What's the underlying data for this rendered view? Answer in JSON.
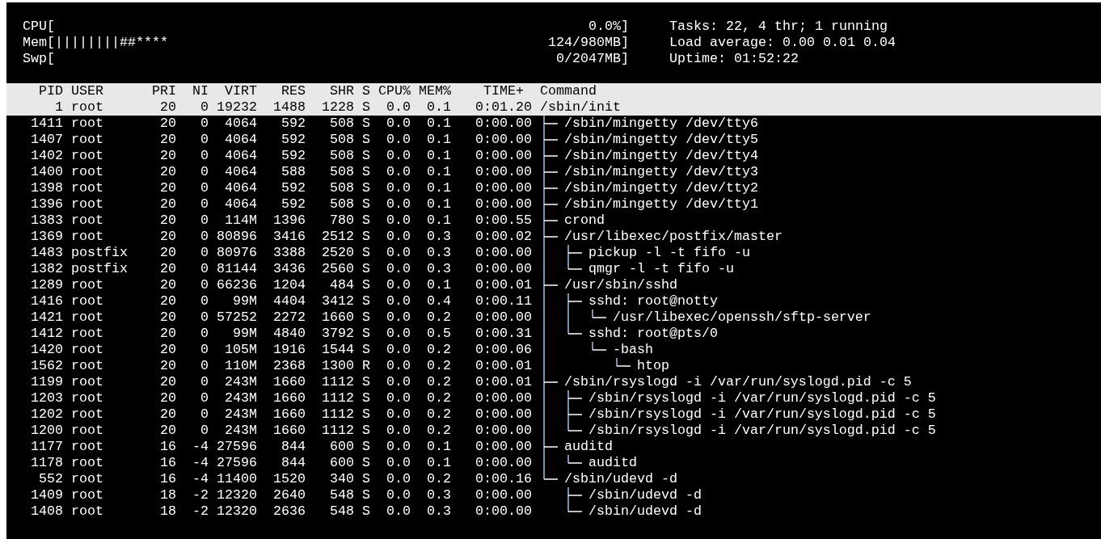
{
  "meters": [
    {
      "label": "CPU[",
      "value": "0.0%]"
    },
    {
      "label": "Mem[",
      "bar": "||||||||##****",
      "value": "124/980MB]"
    },
    {
      "label": "Swp[",
      "value": "0/2047MB]"
    }
  ],
  "summary": [
    "Tasks: 22, 4 thr; 1 running",
    "Load average: 0.00 0.01 0.04",
    "Uptime: 01:52:22"
  ],
  "columns": [
    "PID",
    "USER",
    "PRI",
    "NI",
    "VIRT",
    "RES",
    "SHR",
    "S",
    "CPU%",
    "MEM%",
    "TIME+",
    "Command"
  ],
  "processes": [
    {
      "pid": "1",
      "user": "root",
      "pri": "20",
      "ni": "0",
      "virt": "19232",
      "res": "1488",
      "shr": "1228",
      "s": "S",
      "cpu": "0.0",
      "mem": "0.1",
      "time": "0:01.20",
      "command": "/sbin/init",
      "selected": true,
      "children": [
        {
          "pid": "1411",
          "user": "root",
          "pri": "20",
          "ni": "0",
          "virt": "4064",
          "res": "592",
          "shr": "508",
          "s": "S",
          "cpu": "0.0",
          "mem": "0.1",
          "time": "0:00.00",
          "command": "/sbin/mingetty /dev/tty6",
          "selected": false
        },
        {
          "pid": "1407",
          "user": "root",
          "pri": "20",
          "ni": "0",
          "virt": "4064",
          "res": "592",
          "shr": "508",
          "s": "S",
          "cpu": "0.0",
          "mem": "0.1",
          "time": "0:00.00",
          "command": "/sbin/mingetty /dev/tty5",
          "selected": false
        },
        {
          "pid": "1402",
          "user": "root",
          "pri": "20",
          "ni": "0",
          "virt": "4064",
          "res": "592",
          "shr": "508",
          "s": "S",
          "cpu": "0.0",
          "mem": "0.1",
          "time": "0:00.00",
          "command": "/sbin/mingetty /dev/tty4",
          "selected": false
        },
        {
          "pid": "1400",
          "user": "root",
          "pri": "20",
          "ni": "0",
          "virt": "4064",
          "res": "588",
          "shr": "508",
          "s": "S",
          "cpu": "0.0",
          "mem": "0.1",
          "time": "0:00.00",
          "command": "/sbin/mingetty /dev/tty3",
          "selected": false
        },
        {
          "pid": "1398",
          "user": "root",
          "pri": "20",
          "ni": "0",
          "virt": "4064",
          "res": "592",
          "shr": "508",
          "s": "S",
          "cpu": "0.0",
          "mem": "0.1",
          "time": "0:00.00",
          "command": "/sbin/mingetty /dev/tty2",
          "selected": false
        },
        {
          "pid": "1396",
          "user": "root",
          "pri": "20",
          "ni": "0",
          "virt": "4064",
          "res": "592",
          "shr": "508",
          "s": "S",
          "cpu": "0.0",
          "mem": "0.1",
          "time": "0:00.00",
          "command": "/sbin/mingetty /dev/tty1",
          "selected": false
        },
        {
          "pid": "1383",
          "user": "root",
          "pri": "20",
          "ni": "0",
          "virt": "114M",
          "res": "1396",
          "shr": "780",
          "s": "S",
          "cpu": "0.0",
          "mem": "0.1",
          "time": "0:00.55",
          "command": "crond",
          "selected": false
        },
        {
          "pid": "1369",
          "user": "root",
          "pri": "20",
          "ni": "0",
          "virt": "80896",
          "res": "3416",
          "shr": "2512",
          "s": "S",
          "cpu": "0.0",
          "mem": "0.3",
          "time": "0:00.02",
          "command": "/usr/libexec/postfix/master",
          "selected": false,
          "children": [
            {
              "pid": "1483",
              "user": "postfix",
              "pri": "20",
              "ni": "0",
              "virt": "80976",
              "res": "3388",
              "shr": "2520",
              "s": "S",
              "cpu": "0.0",
              "mem": "0.3",
              "time": "0:00.00",
              "command": "pickup -l -t fifo -u",
              "selected": false
            },
            {
              "pid": "1382",
              "user": "postfix",
              "pri": "20",
              "ni": "0",
              "virt": "81144",
              "res": "3436",
              "shr": "2560",
              "s": "S",
              "cpu": "0.0",
              "mem": "0.3",
              "time": "0:00.00",
              "command": "qmgr -l -t fifo -u",
              "selected": false
            }
          ]
        },
        {
          "pid": "1289",
          "user": "root",
          "pri": "20",
          "ni": "0",
          "virt": "66236",
          "res": "1204",
          "shr": "484",
          "s": "S",
          "cpu": "0.0",
          "mem": "0.1",
          "time": "0:00.01",
          "command": "/usr/sbin/sshd",
          "selected": false,
          "children": [
            {
              "pid": "1416",
              "user": "root",
              "pri": "20",
              "ni": "0",
              "virt": "99M",
              "res": "4404",
              "shr": "3412",
              "s": "S",
              "cpu": "0.0",
              "mem": "0.4",
              "time": "0:00.11",
              "command": "sshd: root@notty",
              "selected": false,
              "children": [
                {
                  "pid": "1421",
                  "user": "root",
                  "pri": "20",
                  "ni": "0",
                  "virt": "57252",
                  "res": "2272",
                  "shr": "1660",
                  "s": "S",
                  "cpu": "0.0",
                  "mem": "0.2",
                  "time": "0:00.00",
                  "command": "/usr/libexec/openssh/sftp-server",
                  "selected": false
                }
              ]
            },
            {
              "pid": "1412",
              "user": "root",
              "pri": "20",
              "ni": "0",
              "virt": "99M",
              "res": "4840",
              "shr": "3792",
              "s": "S",
              "cpu": "0.0",
              "mem": "0.5",
              "time": "0:00.31",
              "command": "sshd: root@pts/0",
              "selected": false,
              "children": [
                {
                  "pid": "1420",
                  "user": "root",
                  "pri": "20",
                  "ni": "0",
                  "virt": "105M",
                  "res": "1916",
                  "shr": "1544",
                  "s": "S",
                  "cpu": "0.0",
                  "mem": "0.2",
                  "time": "0:00.06",
                  "command": "-bash",
                  "selected": false,
                  "children": [
                    {
                      "pid": "1562",
                      "user": "root",
                      "pri": "20",
                      "ni": "0",
                      "virt": "110M",
                      "res": "2368",
                      "shr": "1300",
                      "s": "R",
                      "cpu": "0.0",
                      "mem": "0.2",
                      "time": "0:00.01",
                      "command": "htop",
                      "selected": false
                    }
                  ]
                }
              ]
            }
          ]
        },
        {
          "pid": "1199",
          "user": "root",
          "pri": "20",
          "ni": "0",
          "virt": "243M",
          "res": "1660",
          "shr": "1112",
          "s": "S",
          "cpu": "0.0",
          "mem": "0.2",
          "time": "0:00.01",
          "command": "/sbin/rsyslogd -i /var/run/syslogd.pid -c 5",
          "selected": false,
          "children": [
            {
              "pid": "1203",
              "user": "root",
              "pri": "20",
              "ni": "0",
              "virt": "243M",
              "res": "1660",
              "shr": "1112",
              "s": "S",
              "cpu": "0.0",
              "mem": "0.2",
              "time": "0:00.00",
              "command": "/sbin/rsyslogd -i /var/run/syslogd.pid -c 5",
              "selected": false
            },
            {
              "pid": "1202",
              "user": "root",
              "pri": "20",
              "ni": "0",
              "virt": "243M",
              "res": "1660",
              "shr": "1112",
              "s": "S",
              "cpu": "0.0",
              "mem": "0.2",
              "time": "0:00.00",
              "command": "/sbin/rsyslogd -i /var/run/syslogd.pid -c 5",
              "selected": false
            },
            {
              "pid": "1200",
              "user": "root",
              "pri": "20",
              "ni": "0",
              "virt": "243M",
              "res": "1660",
              "shr": "1112",
              "s": "S",
              "cpu": "0.0",
              "mem": "0.2",
              "time": "0:00.00",
              "command": "/sbin/rsyslogd -i /var/run/syslogd.pid -c 5",
              "selected": false
            }
          ]
        },
        {
          "pid": "1177",
          "user": "root",
          "pri": "16",
          "ni": "-4",
          "virt": "27596",
          "res": "844",
          "shr": "600",
          "s": "S",
          "cpu": "0.0",
          "mem": "0.1",
          "time": "0:00.00",
          "command": "auditd",
          "selected": false,
          "children": [
            {
              "pid": "1178",
              "user": "root",
              "pri": "16",
              "ni": "-4",
              "virt": "27596",
              "res": "844",
              "shr": "600",
              "s": "S",
              "cpu": "0.0",
              "mem": "0.1",
              "time": "0:00.00",
              "command": "auditd",
              "selected": false
            }
          ]
        },
        {
          "pid": "552",
          "user": "root",
          "pri": "16",
          "ni": "-4",
          "virt": "11400",
          "res": "1520",
          "shr": "340",
          "s": "S",
          "cpu": "0.0",
          "mem": "0.2",
          "time": "0:00.16",
          "command": "/sbin/udevd -d",
          "selected": false,
          "children": [
            {
              "pid": "1409",
              "user": "root",
              "pri": "18",
              "ni": "-2",
              "virt": "12320",
              "res": "2640",
              "shr": "548",
              "s": "S",
              "cpu": "0.0",
              "mem": "0.3",
              "time": "0:00.00",
              "command": "/sbin/udevd -d",
              "selected": false
            },
            {
              "pid": "1408",
              "user": "root",
              "pri": "18",
              "ni": "-2",
              "virt": "12320",
              "res": "2636",
              "shr": "548",
              "s": "S",
              "cpu": "0.0",
              "mem": "0.3",
              "time": "0:00.00",
              "command": "/sbin/udevd -d",
              "selected": false
            }
          ]
        }
      ]
    }
  ]
}
